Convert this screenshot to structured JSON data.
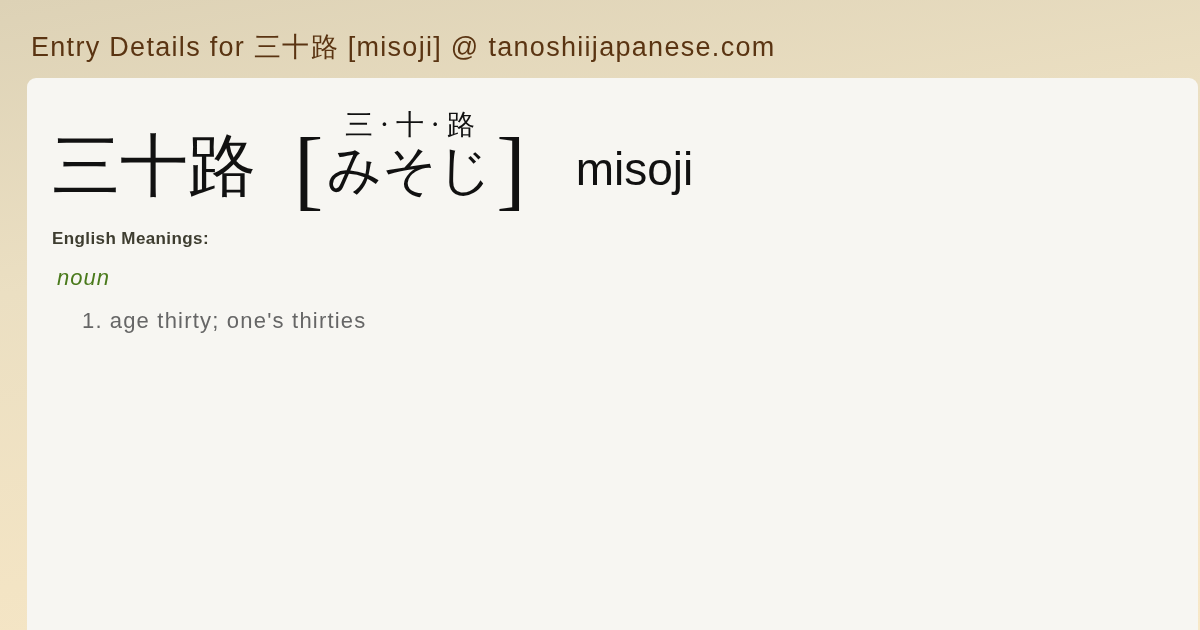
{
  "page_title": "Entry Details for 三十路 [misoji] @ tanoshiijapanese.com",
  "entry": {
    "headword": "三十路",
    "bracket_open": "[",
    "furigana": "三·十·路",
    "reading": "みそじ",
    "bracket_close": "]",
    "romaji": "misoji"
  },
  "meanings": {
    "heading": "English Meanings:",
    "part_of_speech": "noun",
    "senses": [
      {
        "number": "1.",
        "text": "age thirty; one's thirties"
      }
    ]
  }
}
